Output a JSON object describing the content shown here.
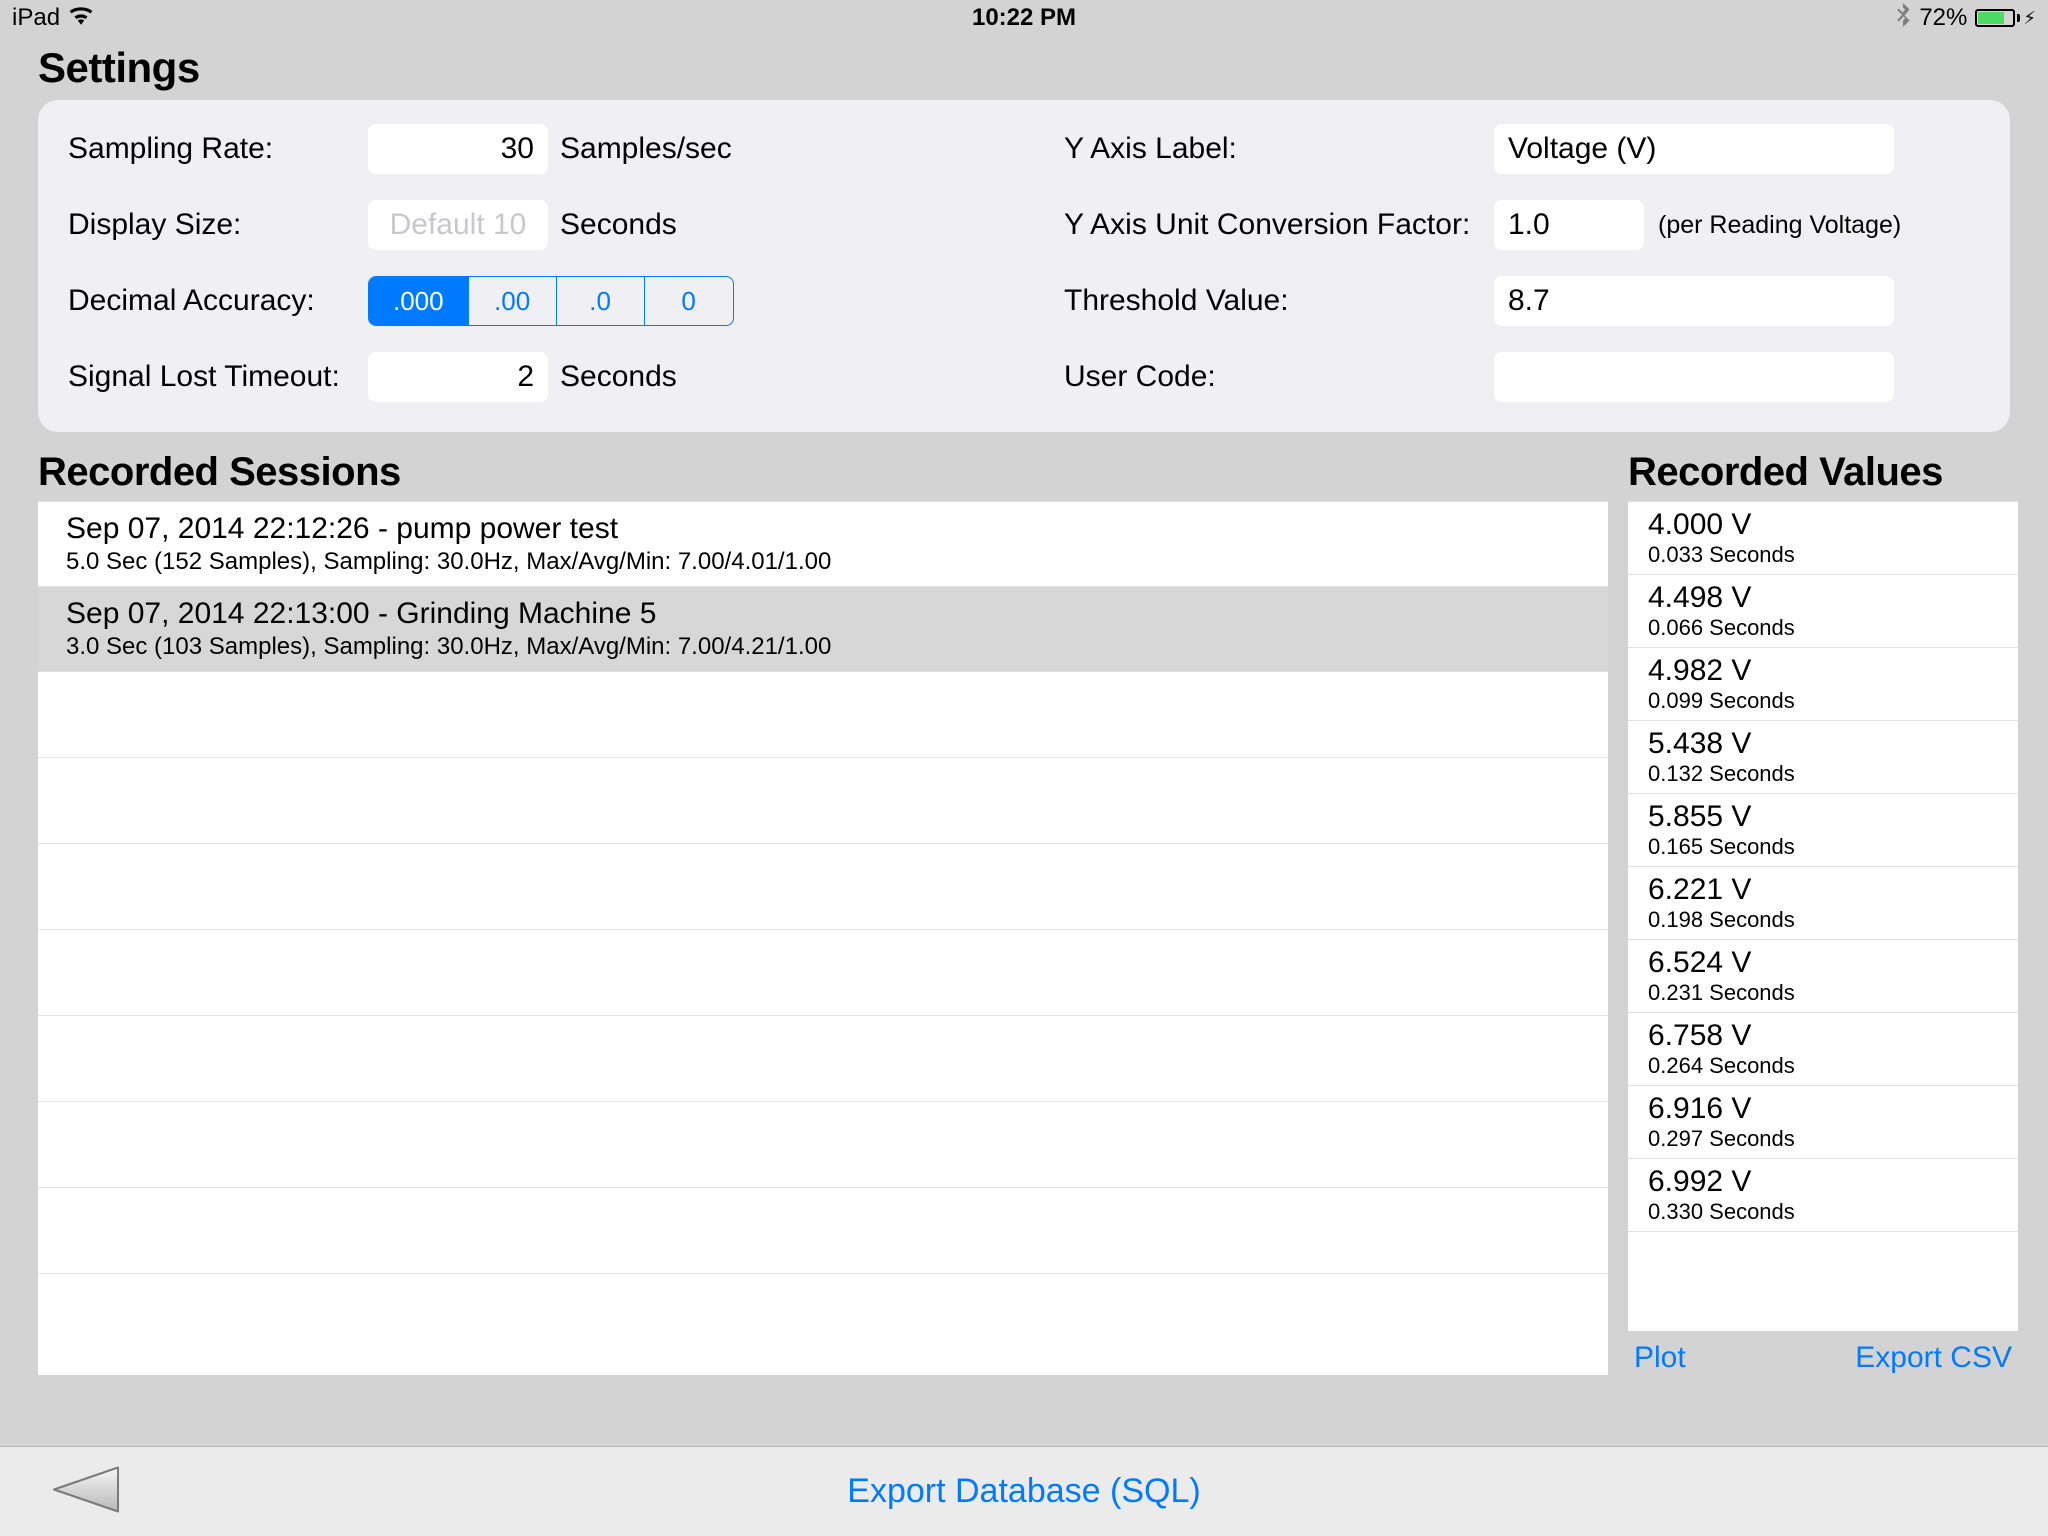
{
  "status_bar": {
    "device": "iPad",
    "time": "10:22 PM",
    "battery_pct": "72%"
  },
  "header": {
    "title": "Settings"
  },
  "settings": {
    "sampling_rate": {
      "label": "Sampling Rate:",
      "value": "30",
      "unit": "Samples/sec"
    },
    "display_size": {
      "label": "Display Size:",
      "placeholder": "Default 10",
      "unit": "Seconds"
    },
    "decimal_accuracy": {
      "label": "Decimal Accuracy:",
      "options": [
        ".000",
        ".00",
        ".0",
        "0"
      ],
      "selected_index": 0
    },
    "signal_lost_timeout": {
      "label": "Signal Lost Timeout:",
      "value": "2",
      "unit": "Seconds"
    },
    "y_axis_label": {
      "label": "Y Axis Label:",
      "value": "Voltage (V)"
    },
    "y_axis_conversion": {
      "label": "Y Axis Unit Conversion Factor:",
      "value": "1.0",
      "hint": "(per Reading Voltage)"
    },
    "threshold_value": {
      "label": "Threshold Value:",
      "value": "8.7"
    },
    "user_code": {
      "label": "User Code:",
      "value": ""
    }
  },
  "sessions": {
    "title": "Recorded Sessions",
    "items": [
      {
        "title": "Sep 07, 2014  22:12:26  -  pump power test",
        "sub": "5.0 Sec (152 Samples), Sampling: 30.0Hz, Max/Avg/Min: 7.00/4.01/1.00",
        "alt": false
      },
      {
        "title": "Sep 07, 2014  22:13:00  -  Grinding Machine 5",
        "sub": "3.0 Sec (103 Samples), Sampling: 30.0Hz, Max/Avg/Min: 7.00/4.21/1.00",
        "alt": true
      }
    ]
  },
  "values": {
    "title": "Recorded Values",
    "items": [
      {
        "v": "4.000 V",
        "t": "0.033 Seconds"
      },
      {
        "v": "4.498 V",
        "t": "0.066 Seconds"
      },
      {
        "v": "4.982 V",
        "t": "0.099 Seconds"
      },
      {
        "v": "5.438 V",
        "t": "0.132 Seconds"
      },
      {
        "v": "5.855 V",
        "t": "0.165 Seconds"
      },
      {
        "v": "6.221 V",
        "t": "0.198 Seconds"
      },
      {
        "v": "6.524 V",
        "t": "0.231 Seconds"
      },
      {
        "v": "6.758 V",
        "t": "0.264 Seconds"
      },
      {
        "v": "6.916 V",
        "t": "0.297 Seconds"
      },
      {
        "v": "6.992 V",
        "t": "0.330 Seconds"
      }
    ],
    "footer": {
      "plot": "Plot",
      "export_csv": "Export CSV"
    }
  },
  "bottom": {
    "export_db": "Export Database (SQL)"
  }
}
